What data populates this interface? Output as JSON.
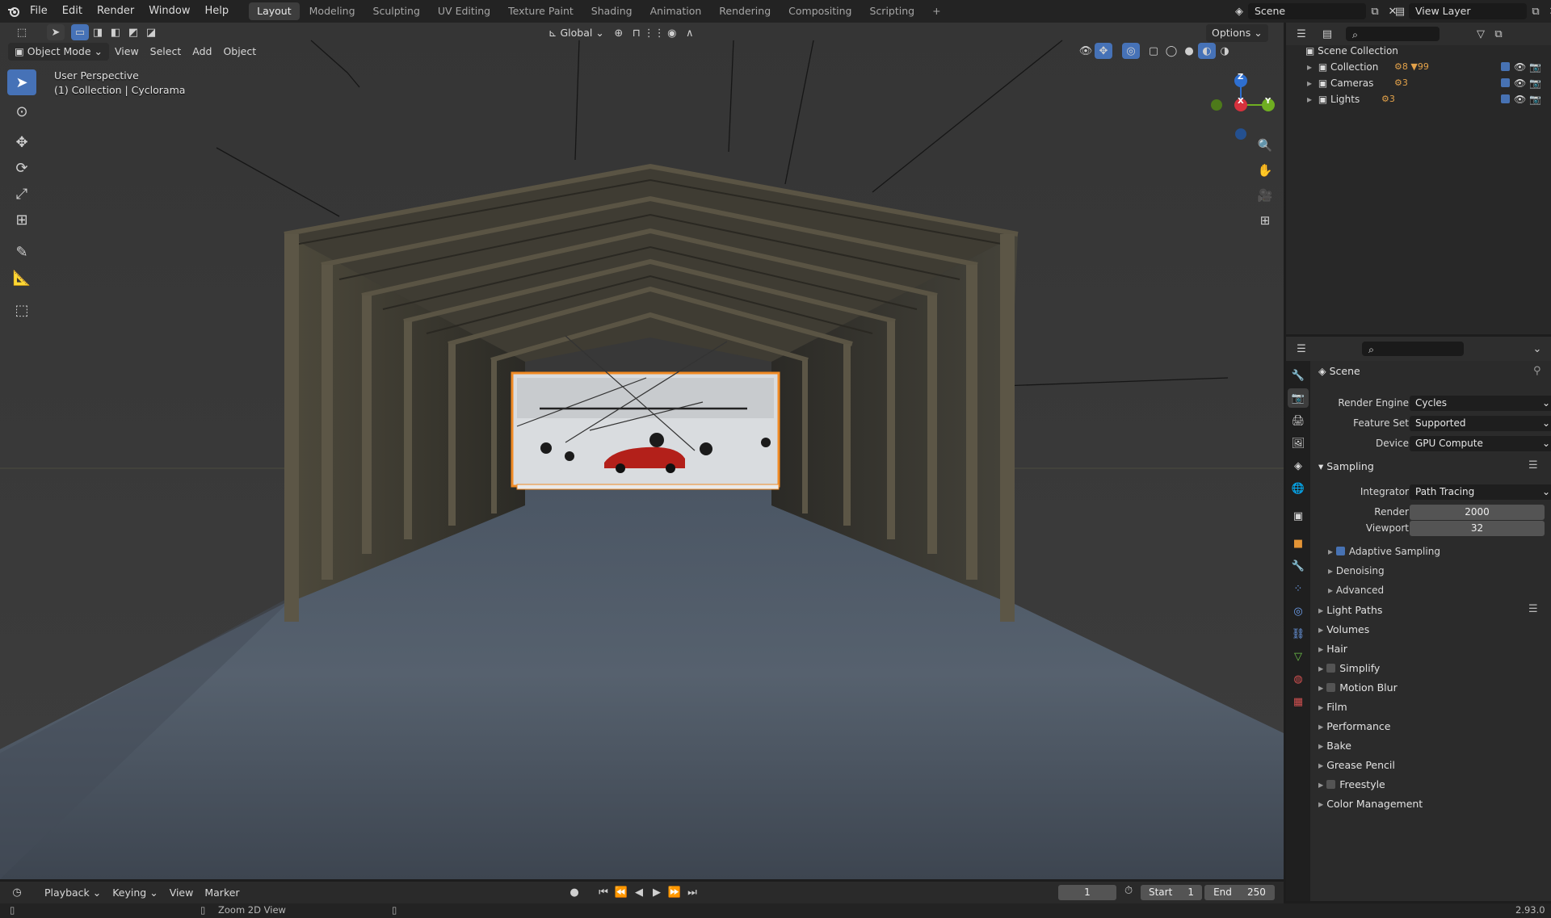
{
  "topbar": {
    "menus": [
      "File",
      "Edit",
      "Render",
      "Window",
      "Help"
    ],
    "workspaces": [
      "Layout",
      "Modeling",
      "Sculpting",
      "UV Editing",
      "Texture Paint",
      "Shading",
      "Animation",
      "Rendering",
      "Compositing",
      "Scripting"
    ],
    "active_workspace": "Layout",
    "add_workspace": "+",
    "scene_name": "Scene",
    "view_layer": "View Layer"
  },
  "viewport": {
    "mode": "Object Mode",
    "menus": [
      "View",
      "Select",
      "Add",
      "Object"
    ],
    "transform_orientation": "Global",
    "options": "Options",
    "perspective_label": "User Perspective",
    "object_label": "(1) Collection | Cyclorama",
    "gizmo": {
      "z": "Z",
      "x": "X",
      "y": "Y"
    }
  },
  "outliner": {
    "root": "Scene Collection",
    "items": [
      {
        "label": "Collection",
        "badge1": "8",
        "badge2": "99"
      },
      {
        "label": "Cameras",
        "badge1": "3"
      },
      {
        "label": "Lights",
        "badge1": "3"
      }
    ]
  },
  "properties": {
    "context": "Scene",
    "render_engine_label": "Render Engine",
    "render_engine": "Cycles",
    "feature_set_label": "Feature Set",
    "feature_set": "Supported",
    "device_label": "Device",
    "device": "GPU Compute",
    "sampling": {
      "title": "Sampling",
      "integrator_label": "Integrator",
      "integrator": "Path Tracing",
      "render_label": "Render",
      "render_samples": "2000",
      "viewport_label": "Viewport",
      "viewport_samples": "32",
      "adaptive_sampling": "Adaptive Sampling",
      "denoising": "Denoising",
      "advanced": "Advanced"
    },
    "panels": [
      "Light Paths",
      "Volumes",
      "Hair",
      "Simplify",
      "Motion Blur",
      "Film",
      "Performance",
      "Bake",
      "Grease Pencil",
      "Freestyle",
      "Color Management"
    ]
  },
  "timeline": {
    "menus": [
      "Playback",
      "Keying",
      "View",
      "Marker"
    ],
    "current_frame": "1",
    "start_label": "Start",
    "start": "1",
    "end_label": "End",
    "end": "250"
  },
  "statusbar": {
    "hint": "Zoom 2D View",
    "version": "2.93.0"
  }
}
